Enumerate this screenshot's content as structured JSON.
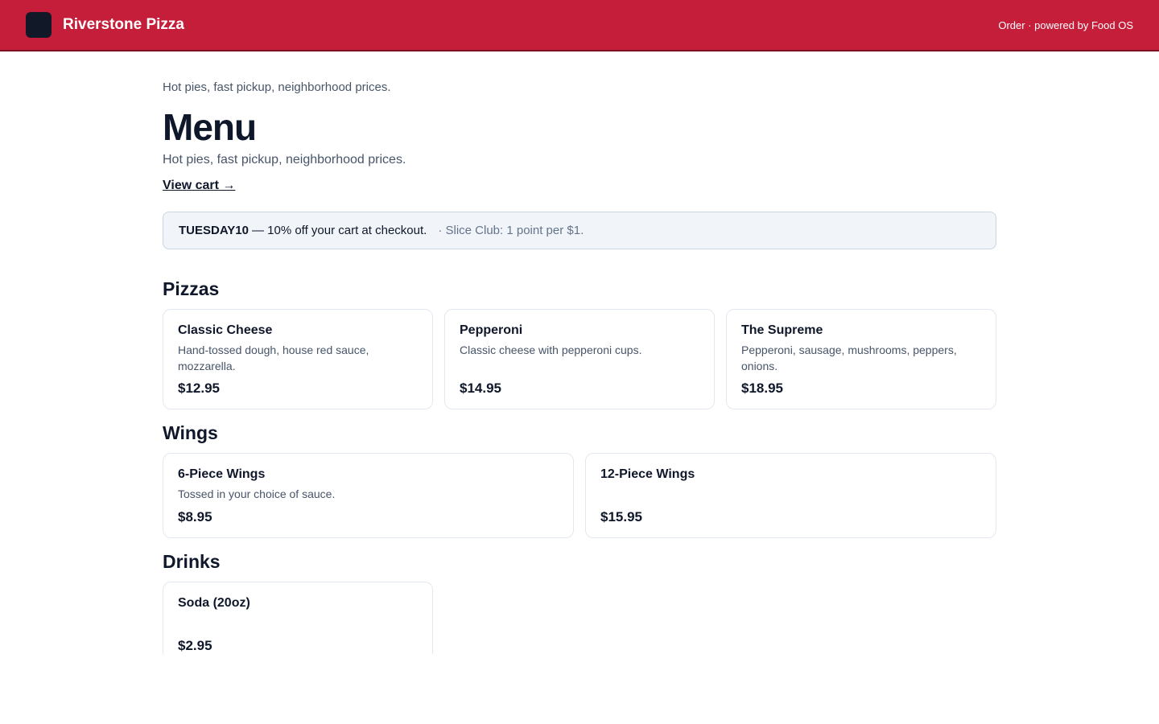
{
  "header": {
    "brand": "Riverstone Pizza",
    "powered_by": "Order · powered by Food OS"
  },
  "hero": {
    "tagline_top": "Hot pies, fast pickup, neighborhood prices.",
    "title": "Menu",
    "tagline": "Hot pies, fast pickup, neighborhood prices.",
    "view_cart": "View cart →"
  },
  "promo": {
    "code": "TUESDAY10",
    "text": "— 10% off your cart at checkout.",
    "club": "· Slice Club: 1 point per $1."
  },
  "sections": [
    {
      "title": "Pizzas",
      "items": [
        {
          "name": "Classic Cheese",
          "desc": "Hand-tossed dough, house red sauce, mozzarella.",
          "price": "$12.95"
        },
        {
          "name": "Pepperoni",
          "desc": "Classic cheese with pepperoni cups.",
          "price": "$14.95"
        },
        {
          "name": "The Supreme",
          "desc": "Pepperoni, sausage, mushrooms, peppers, onions.",
          "price": "$18.95"
        }
      ]
    },
    {
      "title": "Wings",
      "items": [
        {
          "name": "6-Piece Wings",
          "desc": "Tossed in your choice of sauce.",
          "price": "$8.95"
        },
        {
          "name": "12-Piece Wings",
          "desc": "",
          "price": "$15.95"
        }
      ]
    },
    {
      "title": "Drinks",
      "items": [
        {
          "name": "Soda (20oz)",
          "desc": "",
          "price": "$2.95"
        }
      ]
    }
  ],
  "colors": {
    "brand_red": "#c41e3a",
    "text_dark": "#0f172a",
    "text_muted": "#475569"
  }
}
